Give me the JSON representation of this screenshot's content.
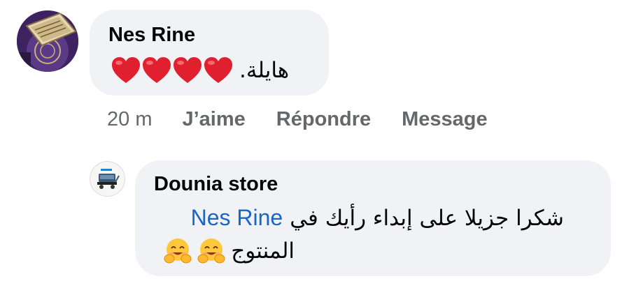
{
  "comments": [
    {
      "author": "Nes Rine",
      "text": "هايلة.",
      "reaction_icons": [
        "heart-emoji",
        "heart-emoji",
        "heart-emoji",
        "heart-emoji"
      ],
      "actions": {
        "time": "20 m",
        "like": "J’aime",
        "reply": "Répondre",
        "message": "Message"
      }
    }
  ],
  "reply": {
    "author": "Dounia store",
    "mention": "Nes Rine",
    "text_line1": "شكرا جزيلا على إبداء رأيك في",
    "text_line2": "المنتوج",
    "emoji_icons": [
      "hugging-face-emoji",
      "hugging-face-emoji"
    ]
  },
  "colors": {
    "bubble": "#f0f2f5",
    "mention": "#1a66c7",
    "secondary_text": "#65676b",
    "heart": "#e0202f"
  }
}
